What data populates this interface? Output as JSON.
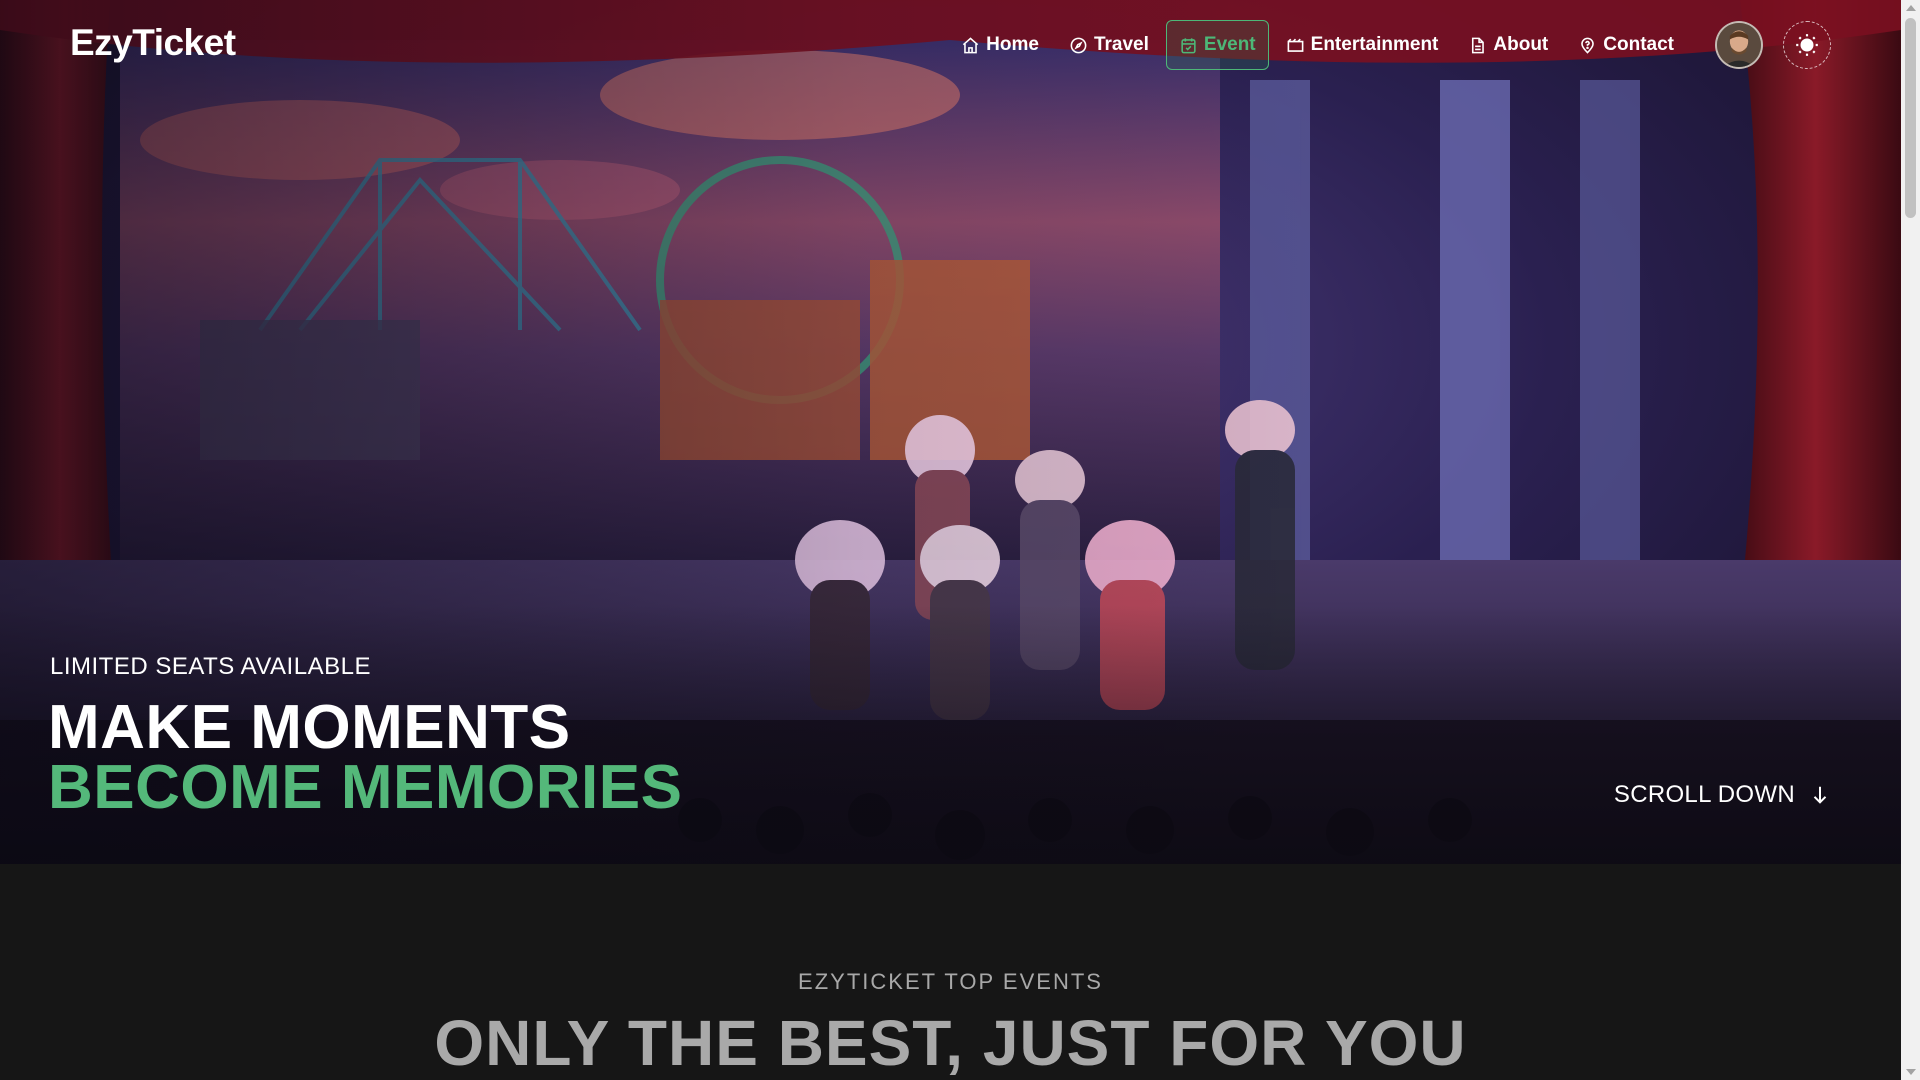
{
  "brand": {
    "name": "EzyTicket"
  },
  "nav": {
    "items": [
      {
        "label": "Home",
        "icon": "home-icon"
      },
      {
        "label": "Travel",
        "icon": "compass-icon"
      },
      {
        "label": "Event",
        "icon": "calendar-icon",
        "active": true
      },
      {
        "label": "Entertainment",
        "icon": "ticket-icon"
      },
      {
        "label": "About",
        "icon": "document-icon"
      },
      {
        "label": "Contact",
        "icon": "help-circle-icon"
      }
    ],
    "avatar": "user-avatar",
    "theme_toggle": "sun-icon"
  },
  "hero": {
    "tagline": "LIMITED SEATS AVAILABLE",
    "headline_line1": "MAKE MOMENTS",
    "headline_line2": "BECOME MEMORIES",
    "scroll_label": "SCROLL DOWN",
    "scroll_icon": "arrow-down-icon"
  },
  "section": {
    "kicker": "EZYTICKET TOP EVENTS",
    "title": "ONLY THE BEST, JUST FOR YOU"
  },
  "colors": {
    "accent": "#54b87a",
    "background": "#161616",
    "text_muted": "#a8a8a8"
  }
}
